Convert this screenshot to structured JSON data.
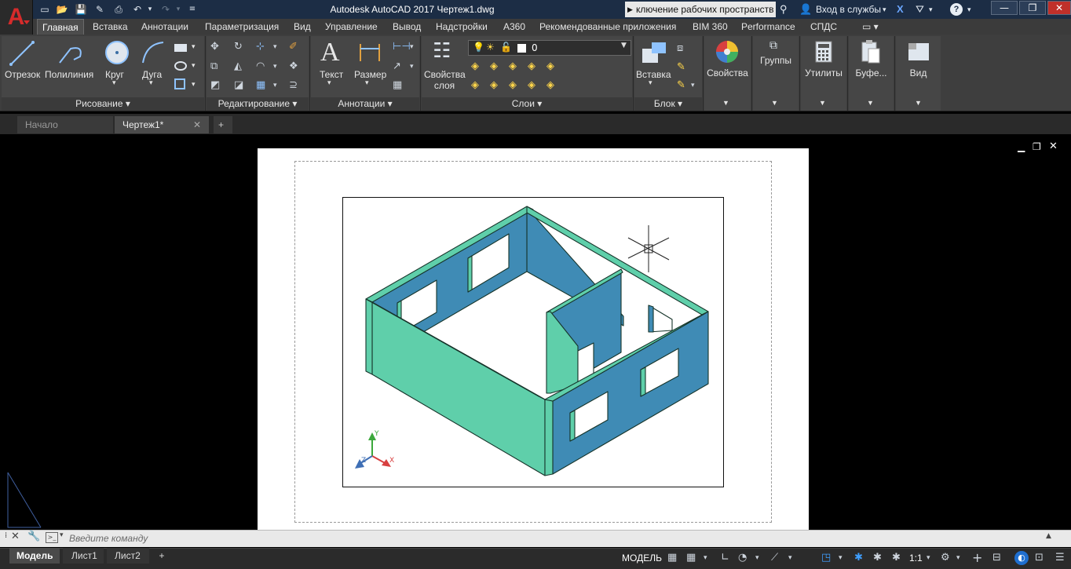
{
  "app": {
    "title": "Autodesk AutoCAD 2017    Чертеж1.dwg",
    "workspace": "ключение рабочих пространств",
    "signin": "Вход в службы"
  },
  "menu_tabs": [
    "Главная",
    "Вставка",
    "Аннотации",
    "Параметризация",
    "Вид",
    "Управление",
    "Вывод",
    "Надстройки",
    "A360",
    "Рекомендованные приложения",
    "BIM 360",
    "Performance",
    "СПДС"
  ],
  "ribbon": {
    "draw": {
      "title": "Рисование",
      "line": "Отрезок",
      "polyline": "Полилиния",
      "circle": "Круг",
      "arc": "Дуга"
    },
    "modify": {
      "title": "Редактирование"
    },
    "annotations": {
      "title": "Аннотации",
      "text": "Текст",
      "dimension": "Размер"
    },
    "layers": {
      "title": "Слои",
      "properties_line1": "Свойства",
      "properties_line2": "слоя",
      "current_layer": "0"
    },
    "block": {
      "title": "Блок",
      "insert": "Вставка"
    },
    "properties": {
      "label": "Свойства"
    },
    "groups": {
      "label": "Группы"
    },
    "utilities": {
      "label": "Утилиты"
    },
    "clipboard": {
      "label": "Буфе..."
    },
    "view": {
      "label": "Вид"
    }
  },
  "file_tabs": {
    "start": "Начало",
    "drawing": "Чертеж1*"
  },
  "command_line": {
    "placeholder": "Введите команду"
  },
  "layout_tabs": [
    "Модель",
    "Лист1",
    "Лист2"
  ],
  "status": {
    "model": "МОДЕЛЬ",
    "scale": "1:1"
  },
  "ucs": {
    "x": "X",
    "y": "Y",
    "z": "Z"
  },
  "colors": {
    "wall_light": "#5fcfaa",
    "wall_dark": "#3f8bb5",
    "titlebar": "#1c2d45",
    "ribbon": "#3e3e3e"
  }
}
